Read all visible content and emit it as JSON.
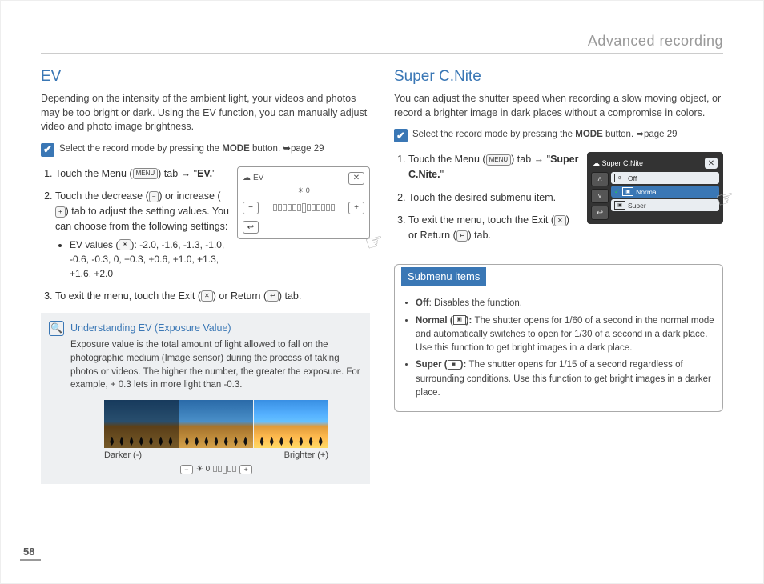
{
  "header": {
    "title": "Advanced recording"
  },
  "page_number": "58",
  "ev": {
    "heading": "EV",
    "intro": "Depending on the intensity of the ambient light, your videos and photos may be too bright or dark. Using the EV function, you can manually adjust video and photo image brightness.",
    "check_note_pre": "Select the record mode by pressing the ",
    "check_note_bold": "MODE",
    "check_note_post": " button. ➥page 29",
    "step1_a": "Touch the Menu (",
    "step1_b": ") tab → \"",
    "step1_c": "EV.",
    "step1_d": "\"",
    "step2_a": "Touch the decrease (",
    "step2_b": ") or increase (",
    "step2_c": ") tab to adjust the setting values. You can choose from the following settings:",
    "bullet_a": "EV values (",
    "bullet_b": "): -2.0, -1.6, -1.3, -1.0, -0.6, -0.3, 0, +0.3, +0.6, +1.0, +1.3, +1.6, +2.0",
    "step3_a": "To exit the menu, touch the Exit (",
    "step3_b": ") or Return (",
    "step3_c": ") tab.",
    "screen": {
      "title": "EV",
      "value": "0",
      "minus": "−",
      "plus": "+",
      "return": "↩",
      "close": "✕"
    },
    "infobox": {
      "title": "Understanding EV (Exposure Value)",
      "body": "Exposure value is the total amount of light allowed to fall on the photographic medium (Image sensor) during the process of taking photos or videos. The higher the number, the greater the exposure. For example, + 0.3 lets in more light than -0.3."
    },
    "tri": {
      "left": "Darker (-)",
      "right": "Brighter (+)",
      "center": "0"
    }
  },
  "scn": {
    "heading": "Super C.Nite",
    "intro": "You can adjust the shutter speed when recording a slow moving object, or record a brighter image in dark places without a compromise in colors.",
    "check_note_pre": "Select the record mode by pressing the ",
    "check_note_bold": "MODE",
    "check_note_post": " button. ➥page 29",
    "step1_a": "Touch the Menu (",
    "step1_b": ") tab → \"",
    "step1_c": "Super C.Nite.",
    "step1_d": "\"",
    "step2": "Touch the desired submenu item.",
    "step3_a": "To exit the menu, touch the Exit (",
    "step3_b": ") or Return (",
    "step3_c": ") tab.",
    "screen": {
      "title": "Super C.Nite",
      "opts": [
        "Off",
        "Normal",
        "Super"
      ],
      "close": "✕",
      "up": "˄",
      "down": "˅",
      "return": "↩"
    },
    "submenu": {
      "title": "Submenu items",
      "off_a": "Off",
      "off_b": ": Disables the function.",
      "normal_a": "Normal (",
      "normal_b": "): ",
      "normal_c": "The shutter opens for 1/60 of a second in the normal mode and automatically switches to open for 1/30 of a second in a dark place. Use this function to get bright images in a dark place.",
      "super_a": "Super (",
      "super_b": "): ",
      "super_c": "The shutter opens for 1/15 of a second regardless of surrounding conditions. Use this function to get bright images in a darker place."
    }
  },
  "icons": {
    "menu": "MENU",
    "minus": "−",
    "plus": "+",
    "ev": "☀",
    "exit": "✕",
    "return": "↩"
  }
}
